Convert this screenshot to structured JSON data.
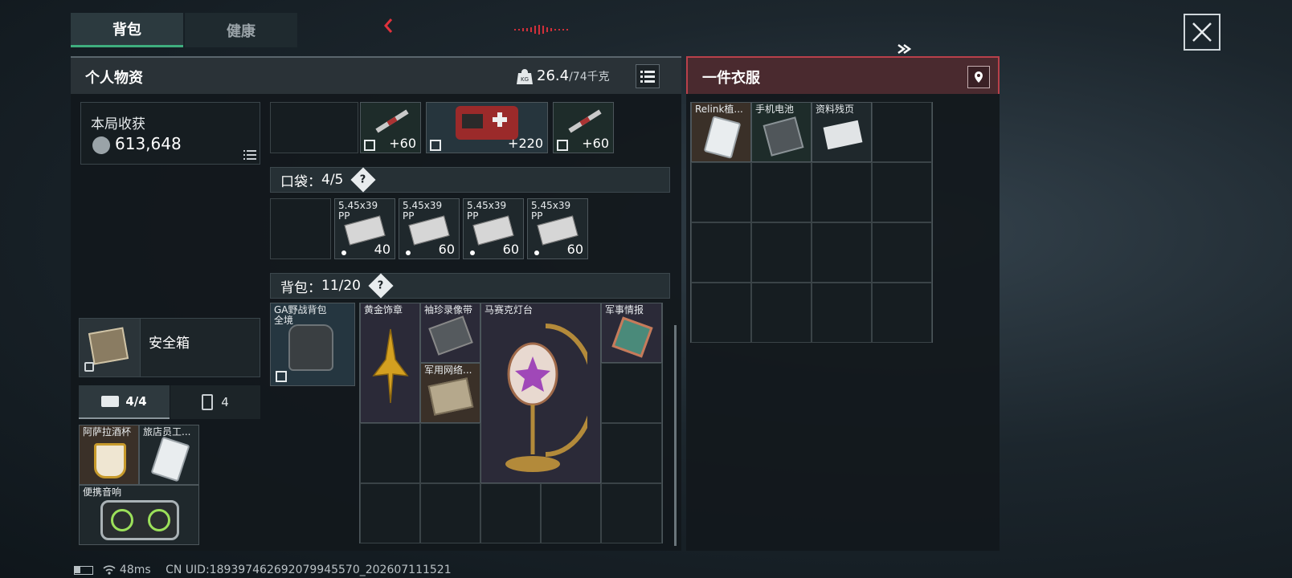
{
  "tabs": {
    "backpack": "背包",
    "health": "健康"
  },
  "left_panel": {
    "title": "个人物资",
    "weight_current": "26.4",
    "weight_max": "/74千克"
  },
  "right_panel": {
    "title": "一件衣服"
  },
  "earnings": {
    "label": "本局收获",
    "amount": "613,648"
  },
  "consumables": [
    {
      "count": "+60"
    },
    {
      "count": "+220"
    },
    {
      "count": "+60"
    }
  ],
  "pocket": {
    "label": "口袋：",
    "count": "4/5",
    "help": "?",
    "items": [
      {
        "name": "5.45x39 PP",
        "count": "40"
      },
      {
        "name": "5.45x39 PP",
        "count": "60"
      },
      {
        "name": "5.45x39 PP",
        "count": "60"
      },
      {
        "name": "5.45x39 PP",
        "count": "60"
      }
    ]
  },
  "backpack_section": {
    "label": "背包：",
    "count": "11/20",
    "help": "?",
    "equipped": "GA野战背包 全境",
    "items": {
      "gold_badge": "黄金饰章",
      "camera_band": "袖珍录像带",
      "mosaic_lamp": "马赛克灯台",
      "military_intel": "军事情报",
      "military_network": "军用网络..."
    }
  },
  "safe_box": {
    "label": "安全箱"
  },
  "sub_tabs": {
    "case": "4/4",
    "items": "4"
  },
  "safe_items": {
    "cup": "阿萨拉酒杯",
    "card": "旅店员工...",
    "speaker": "便携音响"
  },
  "clothing_items": [
    {
      "name": "Relink植..."
    },
    {
      "name": "手机电池"
    },
    {
      "name": "资料残页"
    }
  ],
  "status": {
    "ping": "48ms",
    "uid": "CN UID:1893974626920799455​70_202607111521"
  },
  "colors": {
    "accent_green": "#3fae7e",
    "accent_red": "#b8404a",
    "red_arrow": "#e0323c"
  }
}
